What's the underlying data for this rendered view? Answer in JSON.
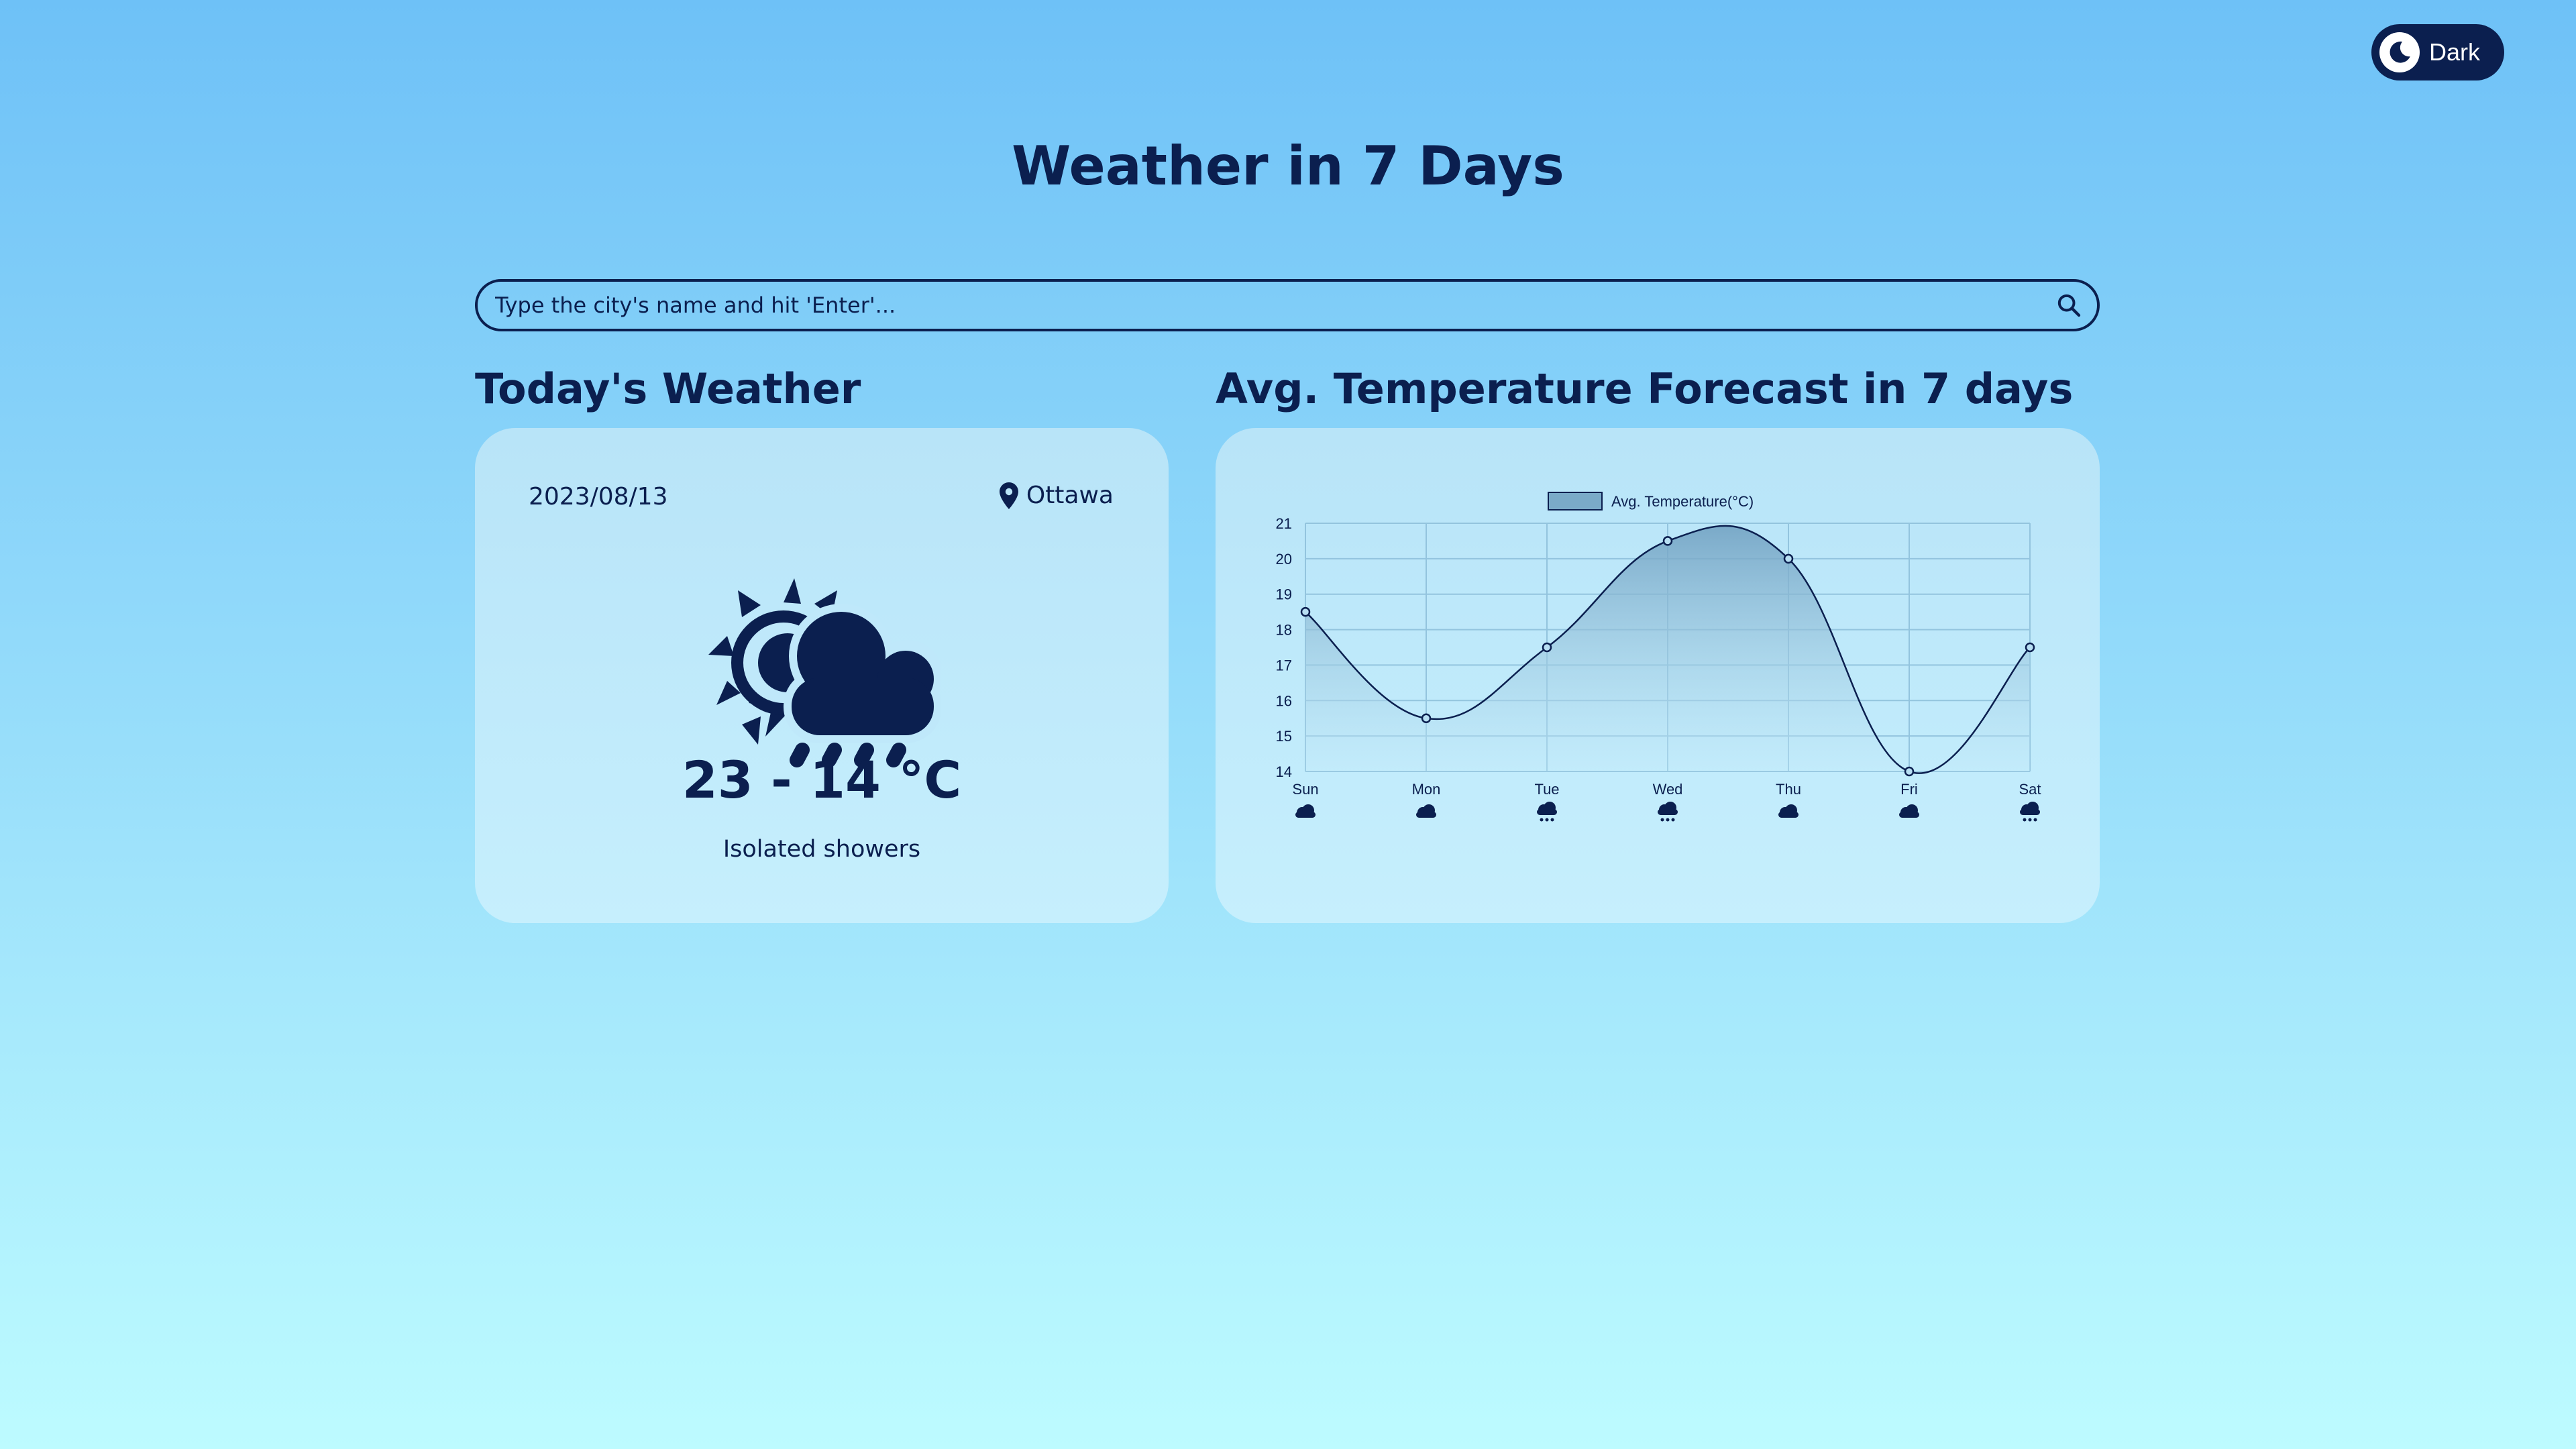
{
  "theme_toggle": {
    "label": "Dark",
    "icon": "moon-icon"
  },
  "page_title": "Weather in 7 Days",
  "search": {
    "placeholder": "Type the city's name and hit 'Enter'...",
    "value": "",
    "icon": "search-icon"
  },
  "today": {
    "heading": "Today's Weather",
    "date": "2023/08/13",
    "location": "Ottawa",
    "location_icon": "map-pin-icon",
    "weather_icon": "sun-cloud-rain-icon",
    "temp_range": "23 - 14 °C",
    "condition": "Isolated showers"
  },
  "forecast": {
    "heading": "Avg. Temperature Forecast in 7 days"
  },
  "chart_data": {
    "type": "area",
    "title": "",
    "xlabel": "",
    "ylabel": "",
    "categories": [
      "Sun",
      "Mon",
      "Tue",
      "Wed",
      "Thu",
      "Fri",
      "Sat"
    ],
    "series": [
      {
        "name": "Avg. Temperature(°C)",
        "values": [
          18.5,
          15.5,
          17.5,
          20.5,
          20,
          14,
          17.5
        ]
      }
    ],
    "ylim": [
      14,
      21
    ],
    "yticks": [
      14,
      15,
      16,
      17,
      18,
      19,
      20,
      21
    ],
    "grid": true,
    "legend": "top-center",
    "curve": "smooth",
    "day_icons": [
      "cloud-icon",
      "cloud-icon",
      "cloud-rain-icon",
      "cloud-rain-icon",
      "cloud-icon",
      "cloud-icon",
      "cloud-rain-icon"
    ],
    "colors": {
      "line": "#0b1f4f",
      "fill_top": "#6f9fc0",
      "fill_bottom": "#c5ecfb",
      "grid": "#93c4de"
    }
  }
}
